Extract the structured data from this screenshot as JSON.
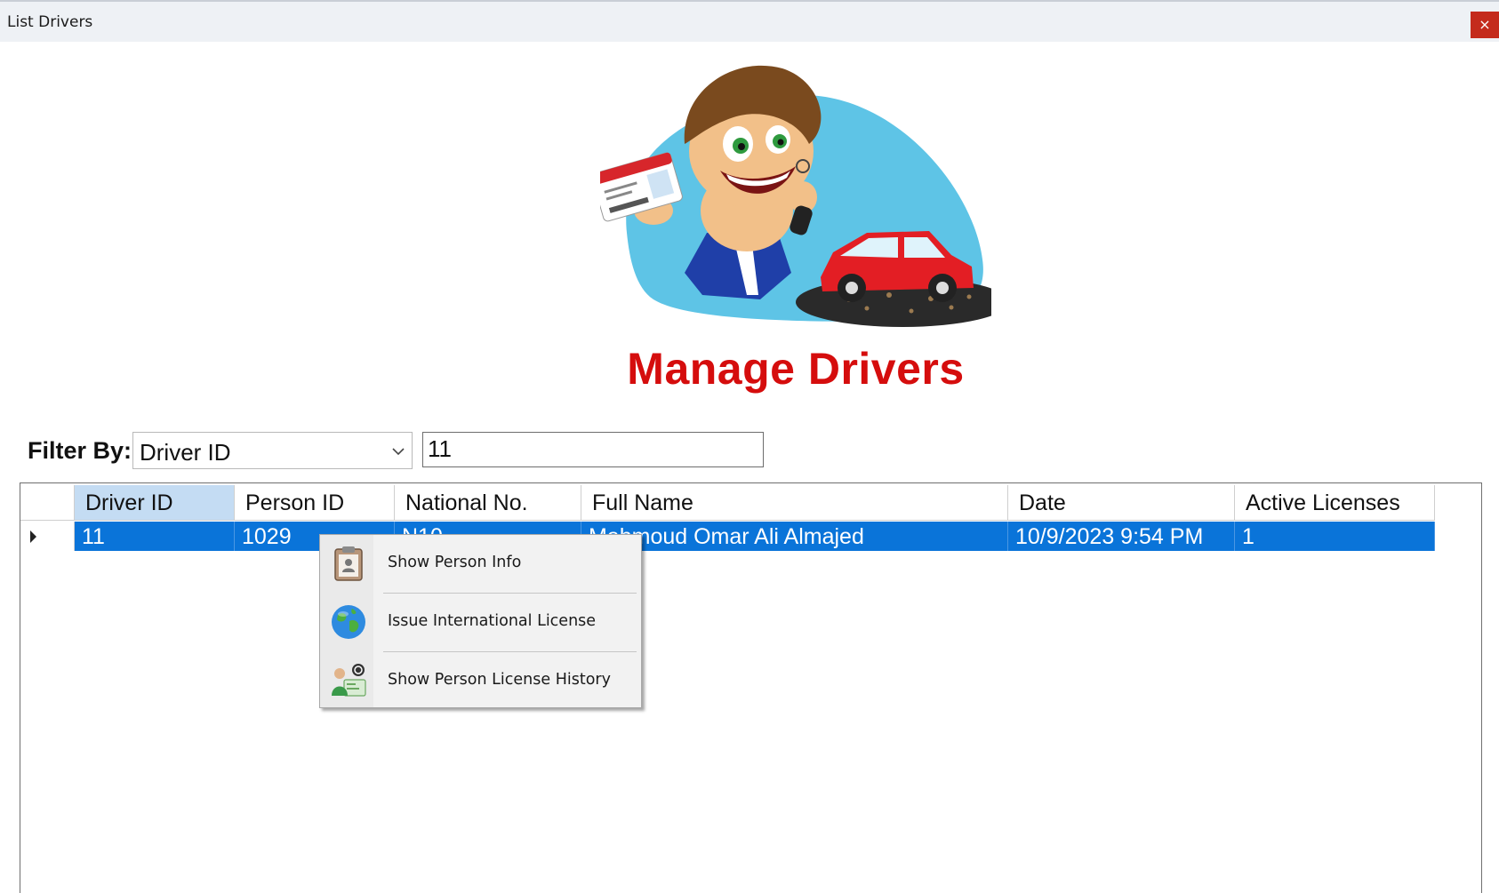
{
  "window": {
    "title": "List Drivers",
    "close_glyph": "×"
  },
  "header": {
    "title": "Manage Drivers"
  },
  "filter": {
    "label": "Filter By:",
    "selected_option": "Driver ID",
    "value": "11"
  },
  "grid": {
    "columns": [
      "Driver ID",
      "Person ID",
      "National No.",
      "Full Name",
      "Date",
      "Active Licenses"
    ],
    "rows": [
      {
        "driver_id": "11",
        "person_id": "1029",
        "national_no": "N10",
        "full_name": "Mahmoud Omar Ali Almajed",
        "date": "10/9/2023 9:54 PM",
        "active_licenses": "1"
      }
    ]
  },
  "context_menu": {
    "items": [
      {
        "label": "Show Person Info",
        "icon": "person-card-icon"
      },
      {
        "label": "Issue International License",
        "icon": "globe-icon"
      },
      {
        "label": "Show Person License History",
        "icon": "license-history-icon"
      }
    ]
  },
  "colors": {
    "title_red": "#d50d0d",
    "selection_blue": "#0a74d9",
    "header_selected": "#c4dcf3",
    "close_red": "#c42b1c"
  }
}
